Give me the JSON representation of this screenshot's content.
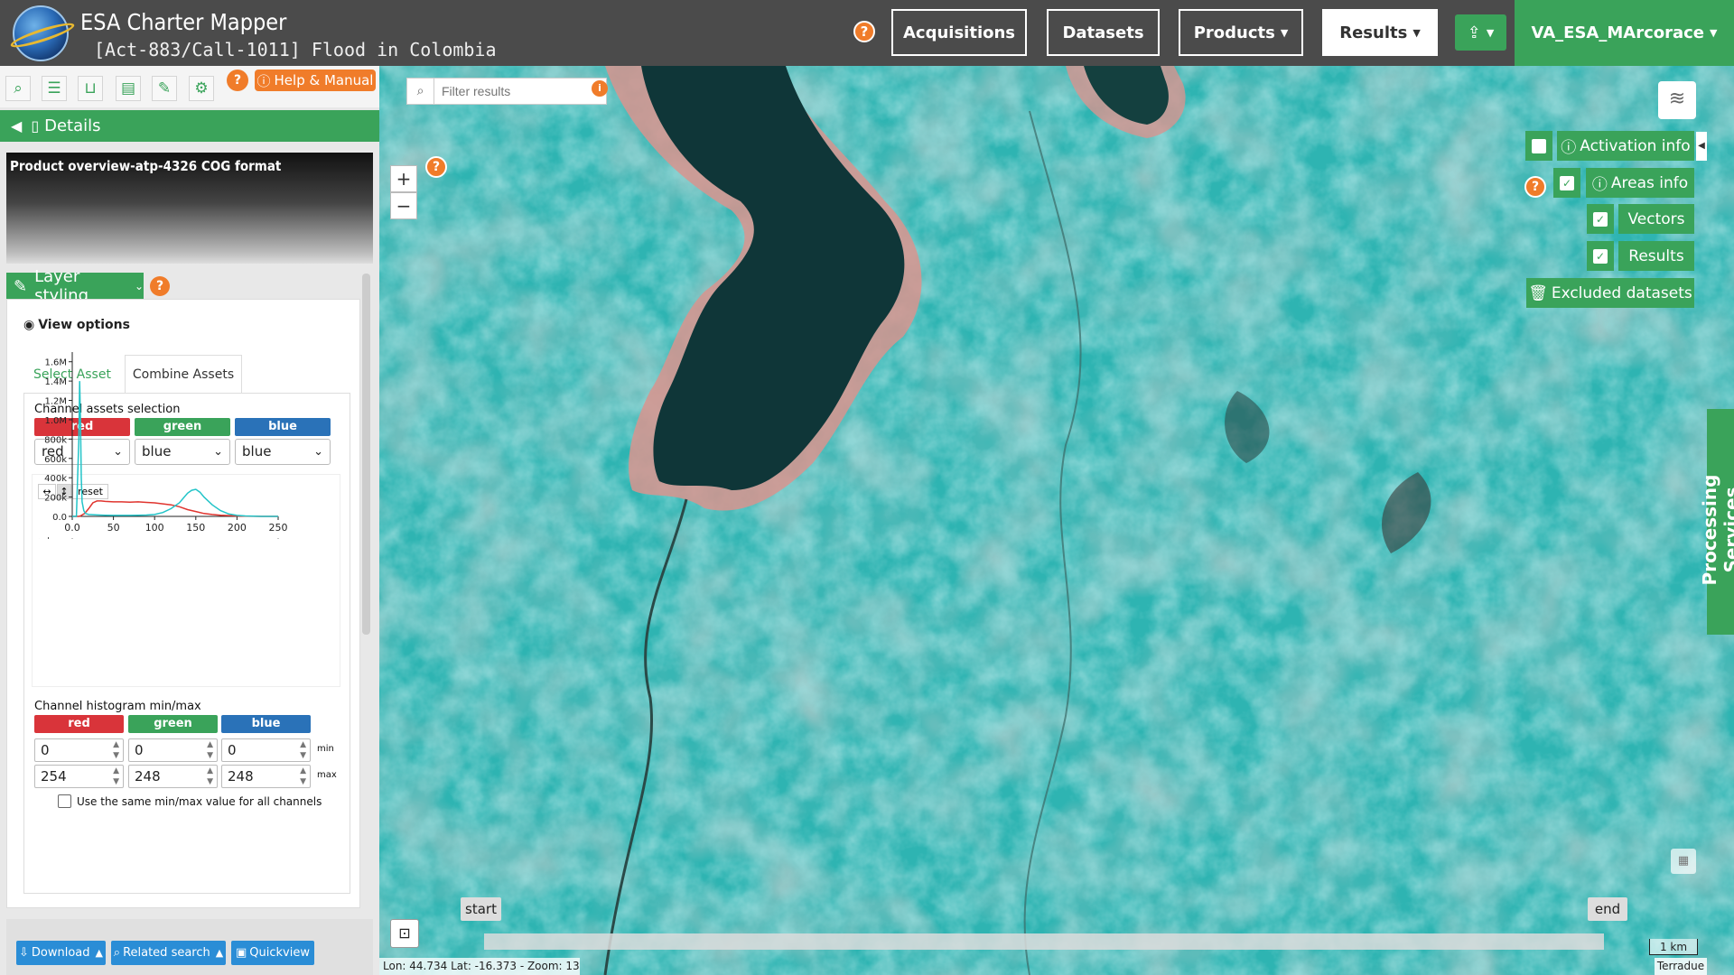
{
  "header": {
    "app_title": "ESA Charter Mapper",
    "activation_title": "[Act-883/Call-1011] Flood in Colombia",
    "help_label": "?",
    "nav": {
      "acquisitions": "Acquisitions",
      "datasets": "Datasets",
      "products": "Products",
      "results": "Results"
    },
    "user": "VA_ESA_MArcorace"
  },
  "toolbar": {
    "help_label": "?",
    "help_manual": "Help & Manual"
  },
  "details": {
    "title": "Details"
  },
  "product": {
    "overview_title": "Product overview-atp-4326 COG format"
  },
  "layer_styling": {
    "title": "Layer styling",
    "help_label": "?",
    "view_options": "View options",
    "tabs": [
      "Select Asset",
      "Combine Assets"
    ],
    "channel_assets_label": "Channel assets selection",
    "channels": [
      "red",
      "green",
      "blue"
    ],
    "selected_assets": [
      "red",
      "blue",
      "blue"
    ],
    "reset_label": "reset",
    "histogram_minmax_label": "Channel histogram min/max",
    "min": [
      "0",
      "0",
      "0"
    ],
    "max": [
      "254",
      "248",
      "248"
    ],
    "min_label": "min",
    "max_label": "max",
    "same_minmax_label": "Use the same min/max value for all channels",
    "slider_labels": [
      "red",
      "green",
      "blue"
    ]
  },
  "chart_data": {
    "type": "line",
    "title": "",
    "xlabel": "",
    "ylabel": "",
    "xlim": [
      0,
      250
    ],
    "ylim": [
      0,
      1700000
    ],
    "x_ticks": [
      "0.0",
      "50",
      "100",
      "150",
      "200",
      "250"
    ],
    "y_ticks": [
      "0.0",
      "200k",
      "400k",
      "600k",
      "800k",
      "1.0M",
      "1.2M",
      "1.4M",
      "1.6M"
    ],
    "series": [
      {
        "color": "#e0342e",
        "x": [
          0,
          5,
          8,
          10,
          12,
          15,
          20,
          25,
          30,
          35,
          40,
          50,
          60,
          70,
          80,
          90,
          100,
          110,
          120,
          130,
          140,
          150,
          160,
          170,
          180,
          190,
          200,
          210,
          220,
          230,
          240,
          250
        ],
        "y": [
          0,
          0,
          0,
          5000,
          15000,
          30000,
          80000,
          140000,
          160000,
          160000,
          155000,
          150000,
          150000,
          148000,
          150000,
          145000,
          140000,
          130000,
          120000,
          100000,
          70000,
          50000,
          30000,
          20000,
          12000,
          8000,
          5000,
          2000,
          1000,
          0,
          0,
          0
        ]
      },
      {
        "color": "#22c4c8",
        "x": [
          0,
          5,
          8,
          9,
          10,
          11,
          12,
          14,
          16,
          20,
          30,
          40,
          50,
          60,
          70,
          80,
          90,
          100,
          110,
          120,
          130,
          140,
          145,
          150,
          155,
          160,
          170,
          180,
          190,
          200,
          210,
          220,
          230,
          240,
          250
        ],
        "y": [
          0,
          0,
          800000,
          1400000,
          1000000,
          400000,
          150000,
          60000,
          30000,
          20000,
          15000,
          12000,
          10000,
          10000,
          10000,
          12000,
          14000,
          20000,
          40000,
          80000,
          140000,
          240000,
          270000,
          280000,
          250000,
          200000,
          120000,
          60000,
          25000,
          10000,
          5000,
          2000,
          0,
          0,
          0
        ]
      }
    ]
  },
  "bottom_actions": {
    "download": "Download",
    "related_search": "Related search",
    "quickview": "Quickview"
  },
  "map": {
    "filter_placeholder": "Filter results",
    "zoom_in": "+",
    "zoom_out": "−",
    "help_label": "?",
    "layers": {
      "activation_info": "Activation info",
      "areas_info": "Areas info",
      "vectors": "Vectors",
      "results": "Results",
      "excluded_datasets": "Excluded datasets"
    },
    "processing_services": "Processing Services",
    "timeline_start": "start",
    "timeline_end": "end",
    "coordinates": "Lon: 44.734 Lat: -16.373 - Zoom: 13",
    "scale": "1 km",
    "attribution": "Terradue"
  },
  "colors": {
    "brand_green": "#3aa35a",
    "help_orange": "#f07c2a",
    "action_blue": "#2a8dd6",
    "header_gray": "#4b4b4b"
  }
}
